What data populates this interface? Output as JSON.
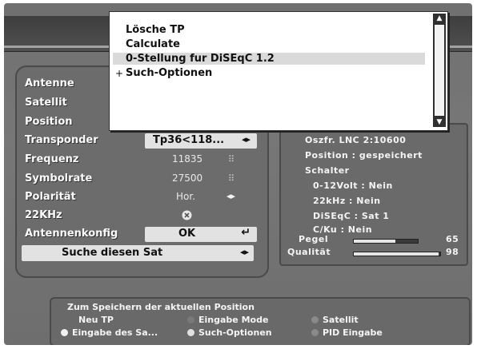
{
  "popup": {
    "items": [
      {
        "label": "Lösche TP"
      },
      {
        "label": "Calculate"
      },
      {
        "label": "0-Stellung fur DiSEqC 1.2"
      },
      {
        "label": "Such-Optionen"
      }
    ],
    "submenu_bullet": "+"
  },
  "left_panel": {
    "antenne": {
      "label": "Antenne"
    },
    "satellit": {
      "label": "Satellit"
    },
    "position": {
      "label": "Position"
    },
    "transponder": {
      "label": "Transponder",
      "value": "Tp36<118..."
    },
    "frequenz": {
      "label": "Frequenz",
      "value": "11835"
    },
    "symbolrate": {
      "label": "Symbolrate",
      "value": "27500"
    },
    "polaritaet": {
      "label": "Polarität",
      "value": "Hor."
    },
    "khz": {
      "label": "22KHz"
    },
    "antennenkonfig": {
      "label": "Antennenkonfig",
      "value": "OK"
    },
    "search_button": {
      "label": "Suche diesen Sat"
    },
    "icons": {
      "arrows": "◂▸",
      "enter": "↵",
      "numpad": "⠿"
    }
  },
  "right_panel": {
    "oszfr": "Oszfr. LNC 2:10600",
    "position": "Position : gespeichert",
    "schalter_title": "Schalter",
    "v12": "0-12Volt : Nein",
    "khz22": "22kHz : Nein",
    "diseqc": "DiSEqC : Sat 1",
    "cku": "C/Ku : Nein",
    "pegel": {
      "label": "Pegel",
      "value": "65",
      "level": 0.65
    },
    "qualitaet": {
      "label": "Qualität",
      "value": "98",
      "level": 0.98
    }
  },
  "legend": {
    "title": "Zum Speichern der aktuellen Position",
    "neu_tp": "Neu TP",
    "eingabe_mode": "Eingabe Mode",
    "satellit": "Satellit",
    "eingabe_sat": "Eingabe des Sa...",
    "such_optionen": "Such-Optionen",
    "pid_eingabe": "PID Eingabe",
    "colors": {
      "red": "#8a8a8a",
      "green": "#7a7a7a",
      "yellow": "#f2f2f2",
      "blue": "#e0e0e0"
    }
  }
}
